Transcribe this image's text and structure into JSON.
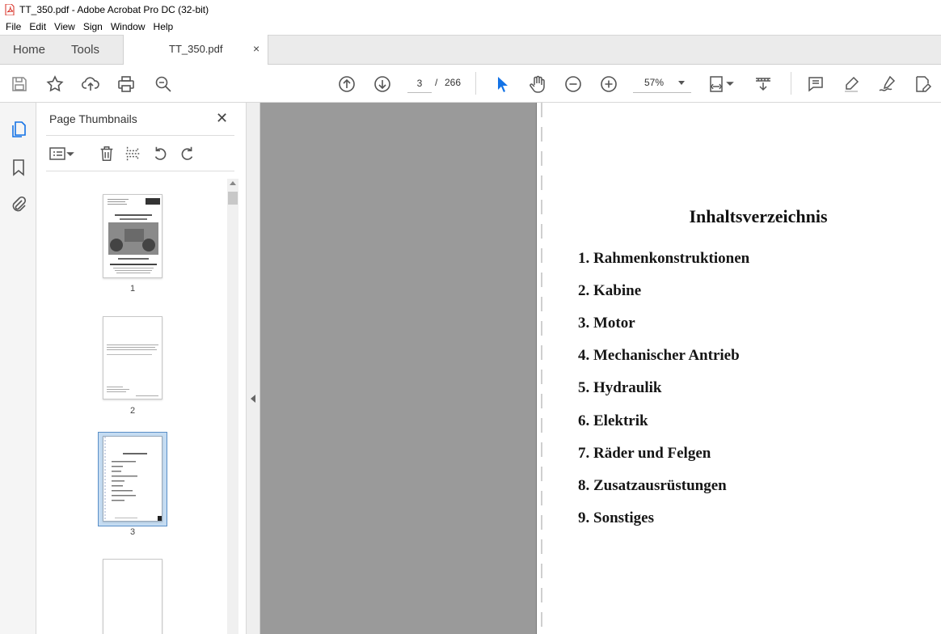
{
  "window": {
    "title": "TT_350.pdf - Adobe Acrobat Pro DC (32-bit)"
  },
  "menu": [
    "File",
    "Edit",
    "View",
    "Sign",
    "Window",
    "Help"
  ],
  "tabs": {
    "home": "Home",
    "tools": "Tools",
    "document": "TT_350.pdf",
    "close": "×"
  },
  "toolbar": {
    "current_page": "3",
    "separator": "/",
    "total_pages": "266",
    "zoom": "57%"
  },
  "sidebar": {
    "title": "Page Thumbnails",
    "close": "✕",
    "thumbnails": [
      {
        "label": "1"
      },
      {
        "label": "2"
      },
      {
        "label": "3"
      }
    ]
  },
  "document": {
    "title": "Inhaltsverzeichnis",
    "toc": [
      "1. Rahmenkonstruktionen",
      "2. Kabine",
      "3. Motor",
      "4. Mechanischer Antrieb",
      "5. Hydraulik",
      "6. Elektrik",
      "7. Räder und Felgen",
      "8. Zusatzausrüstungen",
      "9. Sonstiges"
    ]
  },
  "colors": {
    "accent": "#1473e6",
    "pdf_red": "#d7281e",
    "canvas": "#9a9a9a",
    "selection": "#c5dcf2"
  },
  "icons": [
    "save-icon",
    "star-icon",
    "upload-icon",
    "print-icon",
    "zoom-search-icon",
    "page-up-icon",
    "page-down-icon",
    "select-arrow-icon",
    "hand-icon",
    "zoom-out-icon",
    "zoom-in-icon",
    "fit-page-icon",
    "scroll-mode-icon",
    "comment-icon",
    "highlight-icon",
    "sign-icon",
    "edit-pdf-icon"
  ]
}
